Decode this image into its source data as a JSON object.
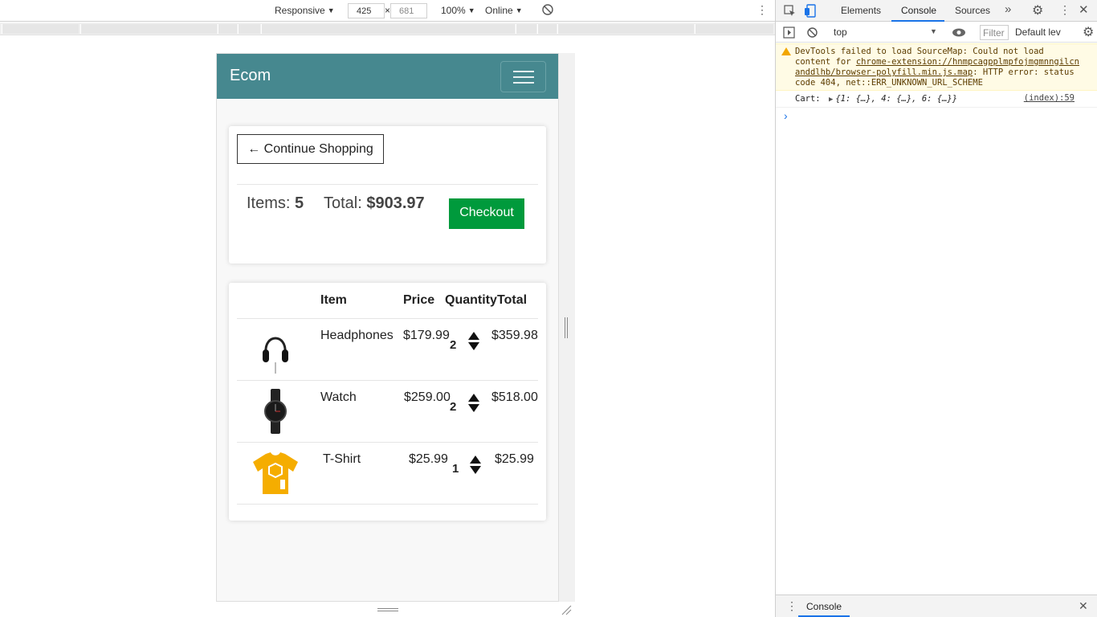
{
  "device_toolbar": {
    "device": "Responsive",
    "width": "425",
    "times": "×",
    "height": "681",
    "zoom": "100%",
    "network": "Online"
  },
  "app": {
    "brand": "Ecom"
  },
  "summary": {
    "continue_label": "← Continue Shopping",
    "items_label": "Items:",
    "items_value": "5",
    "total_label": "Total:",
    "total_value": "$903.97",
    "checkout_label": "Checkout"
  },
  "cart": {
    "headers": [
      "Item",
      "Price",
      "Quantity",
      "Total"
    ],
    "rows": [
      {
        "name": "Headphones",
        "price": "$179.99",
        "qty": "2",
        "total": "$359.98",
        "icon": "headphones-image"
      },
      {
        "name": "Watch",
        "price": "$259.00",
        "qty": "2",
        "total": "$518.00",
        "icon": "watch-image"
      },
      {
        "name": "T-Shirt",
        "price": "$25.99",
        "qty": "1",
        "total": "$25.99",
        "icon": "tshirt-image"
      }
    ]
  },
  "devtools": {
    "tabs": [
      "Elements",
      "Console",
      "Sources"
    ],
    "active_tab": "Console",
    "context": "top",
    "filter_placeholder": "Filter",
    "levels": "Default lev",
    "warning_text": "DevTools failed to load SourceMap: Could not load content for ",
    "warning_link": "chrome-extension://hnmpcagpplmpfojmgmnngilcnanddlhb/browser-polyfill.min.js.map",
    "warning_tail": ": HTTP error: status code 404, net::ERR_UNKNOWN_URL_SCHEME",
    "log_label": "Cart:",
    "log_object": "{1: {…}, 4: {…}, 6: {…}}",
    "log_source": "(index):59",
    "prompt": "›",
    "drawer_tab": "Console"
  },
  "colors": {
    "navbar": "#46888f",
    "checkout": "#009a3c",
    "devtools_accent": "#1a73e8"
  }
}
